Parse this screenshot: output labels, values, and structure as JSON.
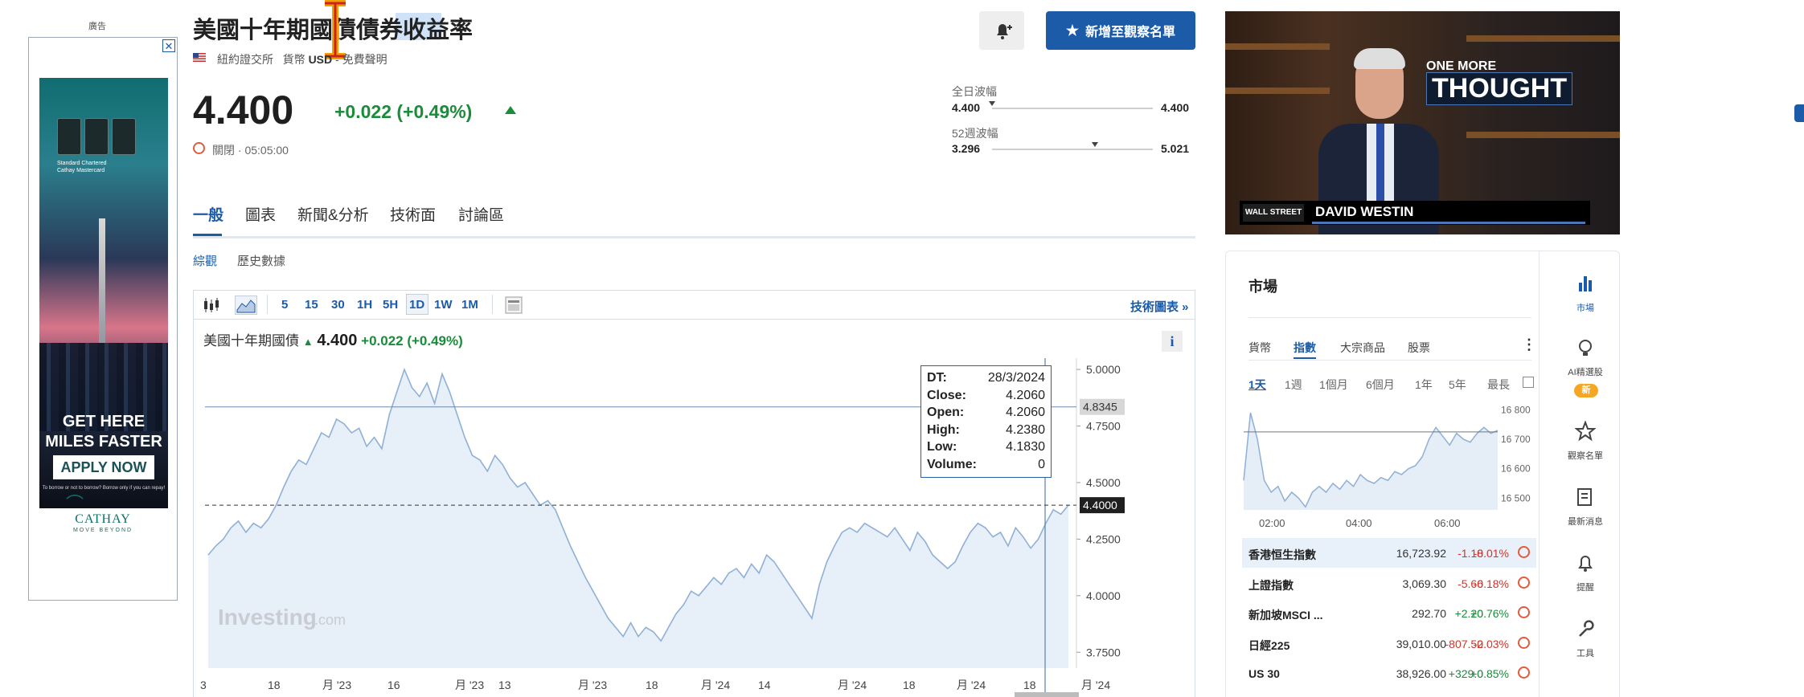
{
  "ad": {
    "label": "廣告",
    "close": "✕",
    "card_text": "Standard Chartered\nCathay Mastercard",
    "headline_1": "GET HERE",
    "headline_2": "MILES FASTER",
    "cta": "APPLY NOW",
    "fine_print": "To borrow or not to borrow? Borrow only if you can repay!",
    "brand": "CATHAY",
    "tagline": "MOVE BEYOND"
  },
  "header": {
    "title": "美國十年期國債債券收益率",
    "exchange": "紐約證交所",
    "currency_label": "貨幣",
    "currency": "USD",
    "disclaimer": "免費聲明",
    "price": "4.400",
    "change": "+0.022 (+0.49%)",
    "status": "關閉 · 05:05:00",
    "watchlist_button": "新增至觀察名單",
    "day_range": {
      "label": "全日波幅",
      "low": "4.400",
      "high": "4.400",
      "position": 0.0
    },
    "week52_range": {
      "label": "52週波幅",
      "low": "3.296",
      "high": "5.021",
      "position": 0.64
    }
  },
  "tabs": [
    "一般",
    "圖表",
    "新聞&分析",
    "技術面",
    "討論區"
  ],
  "subtabs": [
    "綜觀",
    "歷史數據"
  ],
  "chart_toolbar": {
    "intervals": [
      "5",
      "15",
      "30",
      "1H",
      "5H",
      "1D",
      "1W",
      "1M"
    ],
    "active_interval": "1D",
    "tech_chart_link": "技術圖表 »",
    "info": "i"
  },
  "chart_legend": {
    "name": "美國十年期國債",
    "value": "4.400",
    "change": "+0.022 (+0.49%)"
  },
  "tooltip": {
    "rows": [
      {
        "k": "DT:",
        "v": "28/3/2024"
      },
      {
        "k": "Close:",
        "v": "4.2060"
      },
      {
        "k": "Open:",
        "v": "4.2060"
      },
      {
        "k": "High:",
        "v": "4.2380"
      },
      {
        "k": "Low:",
        "v": "4.1830"
      },
      {
        "k": "Volume:",
        "v": "0"
      }
    ]
  },
  "watermark": {
    "brand": "Investing",
    "suffix": ".com"
  },
  "chart_data": {
    "type": "area",
    "title": "美國十年期國債",
    "y_ticks": [
      "5.0000",
      "4.7500",
      "4.5000",
      "4.2500",
      "4.0000",
      "3.7500"
    ],
    "ylim": [
      3.68,
      5.05
    ],
    "x_ticks": [
      "3",
      "18",
      "月 '23",
      "16",
      "月 '23",
      "13",
      "月 '23",
      "18",
      "月 '24",
      "14",
      "月 '24",
      "18",
      "月 '24",
      "18",
      "月 '24"
    ],
    "crosshair_value": "4.8345",
    "last_value": "4.4000",
    "values": [
      4.18,
      4.22,
      4.25,
      4.3,
      4.33,
      4.28,
      4.32,
      4.3,
      4.34,
      4.4,
      4.48,
      4.55,
      4.6,
      4.58,
      4.65,
      4.72,
      4.7,
      4.78,
      4.76,
      4.72,
      4.74,
      4.66,
      4.7,
      4.65,
      4.8,
      4.9,
      5.0,
      4.92,
      4.88,
      4.94,
      4.85,
      4.98,
      4.9,
      4.8,
      4.7,
      4.62,
      4.6,
      4.55,
      4.62,
      4.58,
      4.52,
      4.48,
      4.5,
      4.45,
      4.4,
      4.42,
      4.38,
      4.3,
      4.22,
      4.15,
      4.08,
      4.02,
      3.96,
      3.9,
      3.86,
      3.82,
      3.88,
      3.82,
      3.86,
      3.84,
      3.8,
      3.86,
      3.92,
      3.96,
      4.02,
      4.0,
      4.04,
      4.08,
      4.05,
      4.1,
      4.12,
      4.08,
      4.14,
      4.1,
      4.18,
      4.15,
      4.1,
      4.05,
      4.0,
      3.95,
      3.9,
      4.05,
      4.15,
      4.22,
      4.28,
      4.3,
      4.28,
      4.32,
      4.3,
      4.28,
      4.26,
      4.3,
      4.25,
      4.2,
      4.28,
      4.24,
      4.18,
      4.15,
      4.12,
      4.15,
      4.22,
      4.28,
      4.32,
      4.3,
      4.26,
      4.28,
      4.22,
      4.3,
      4.26,
      4.21,
      4.25,
      4.32,
      4.38,
      4.36,
      4.4
    ]
  },
  "video": {
    "tag_small": "ONE MORE",
    "tag_big": "THOUGHT",
    "show": "WALL STREET",
    "name": "DAVID WESTIN"
  },
  "market": {
    "title": "市場",
    "tabs": [
      "貨幣",
      "指數",
      "大宗商品",
      "股票"
    ],
    "more": "⋮",
    "periods": [
      "1天",
      "1週",
      "1個月",
      "6個月",
      "1年",
      "5年",
      "最長"
    ],
    "mini_chart": {
      "y_ticks": [
        "16 800",
        "16 700",
        "16 600",
        "16 500"
      ],
      "x_ticks": [
        "02:00",
        "04:00",
        "06:00"
      ],
      "ylim": [
        16460,
        16820
      ],
      "values": [
        16560,
        16790,
        16700,
        16560,
        16520,
        16540,
        16490,
        16520,
        16500,
        16470,
        16520,
        16540,
        16520,
        16550,
        16530,
        16560,
        16540,
        16580,
        16560,
        16550,
        16570,
        16560,
        16590,
        16580,
        16600,
        16610,
        16640,
        16700,
        16740,
        16710,
        16680,
        16720,
        16700,
        16690,
        16720,
        16740,
        16720,
        16730
      ]
    },
    "rows": [
      {
        "name": "香港恒生指數",
        "price": "16,723.92",
        "change": "-1.18",
        "pct": "-0.01%",
        "dir": "neg"
      },
      {
        "name": "上證指數",
        "price": "3,069.30",
        "change": "-5.66",
        "pct": "-0.18%",
        "dir": "neg"
      },
      {
        "name": "新加坡MSCI ...",
        "price": "292.70",
        "change": "+2.20",
        "pct": "+0.76%",
        "dir": "pos"
      },
      {
        "name": "日經225",
        "price": "39,010.00",
        "change": "-807.50",
        "pct": "-2.03%",
        "dir": "neg"
      },
      {
        "name": "US 30",
        "price": "38,926.00",
        "change": "+329.0",
        "pct": "+0.85%",
        "dir": "pos"
      }
    ]
  },
  "rail": {
    "items": [
      "市場",
      "AI精選股",
      "觀察名單",
      "最新消息",
      "提醒",
      "工具"
    ],
    "new_badge": "新"
  },
  "colors": {
    "accent": "#1b5ba8",
    "up": "#1a8c3a",
    "down": "#d0352a"
  }
}
